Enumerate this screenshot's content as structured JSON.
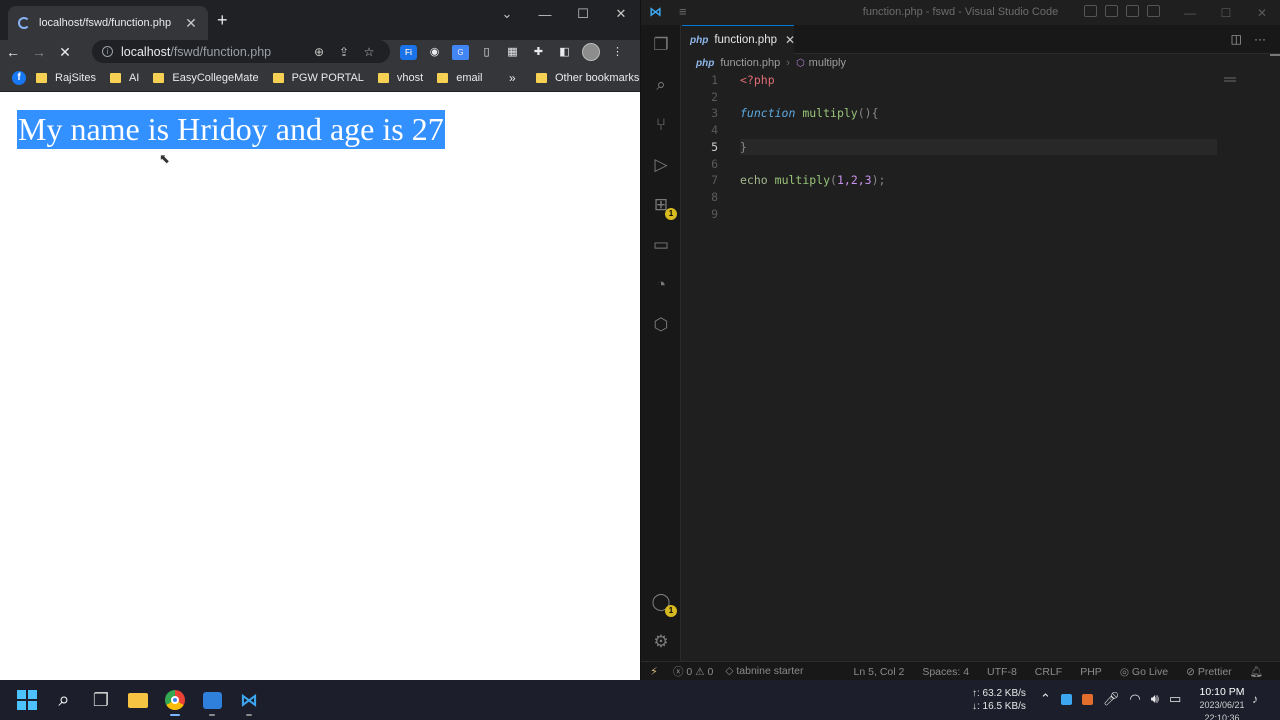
{
  "browser": {
    "tab_title": "localhost/fswd/function.php",
    "new_tab": "+",
    "url_host": "localhost",
    "url_path": "/fswd/function.php",
    "bookmarks": [
      "RajSites",
      "AI",
      "EasyCollegeMate",
      "PGW PORTAL",
      "vhost",
      "email"
    ],
    "bookmarks_more": "»",
    "other_bookmarks": "Other bookmarks",
    "page_text": "My name is Hridoy and age is 27"
  },
  "vscode": {
    "window_title": "function.php - fswd - Visual Studio Code",
    "tab_label": "function.php",
    "breadcrumb_file": "function.php",
    "breadcrumb_symbol": "multiply",
    "line_numbers": [
      "1",
      "2",
      "3",
      "4",
      "5",
      "6",
      "7",
      "8",
      "9"
    ],
    "active_line": 5,
    "code": {
      "l1": "<?php",
      "l3_kw": "function",
      "l3_fn": "multiply",
      "l3_rest": "(){",
      "l5": "}",
      "l7_echo": "echo",
      "l7_fn": "multiply",
      "l7_open": "(",
      "l7_args": "1,2,3",
      "l7_close": ");"
    },
    "status": {
      "errors": "0",
      "warnings": "0",
      "tabnine": "tabnine starter",
      "position": "Ln 5, Col 2",
      "spaces": "Spaces: 4",
      "encoding": "UTF-8",
      "eol": "CRLF",
      "language": "PHP",
      "go_live": "Go Live",
      "prettier": "Prettier"
    },
    "badges": {
      "extensions": "1",
      "accounts": "1"
    }
  },
  "taskbar": {
    "upload_speed": "↑: 63.2 KB/s",
    "download_speed": "↓: 16.5 KB/s",
    "time": "10:10 PM",
    "date": "2023/06/21 22:10:36"
  }
}
